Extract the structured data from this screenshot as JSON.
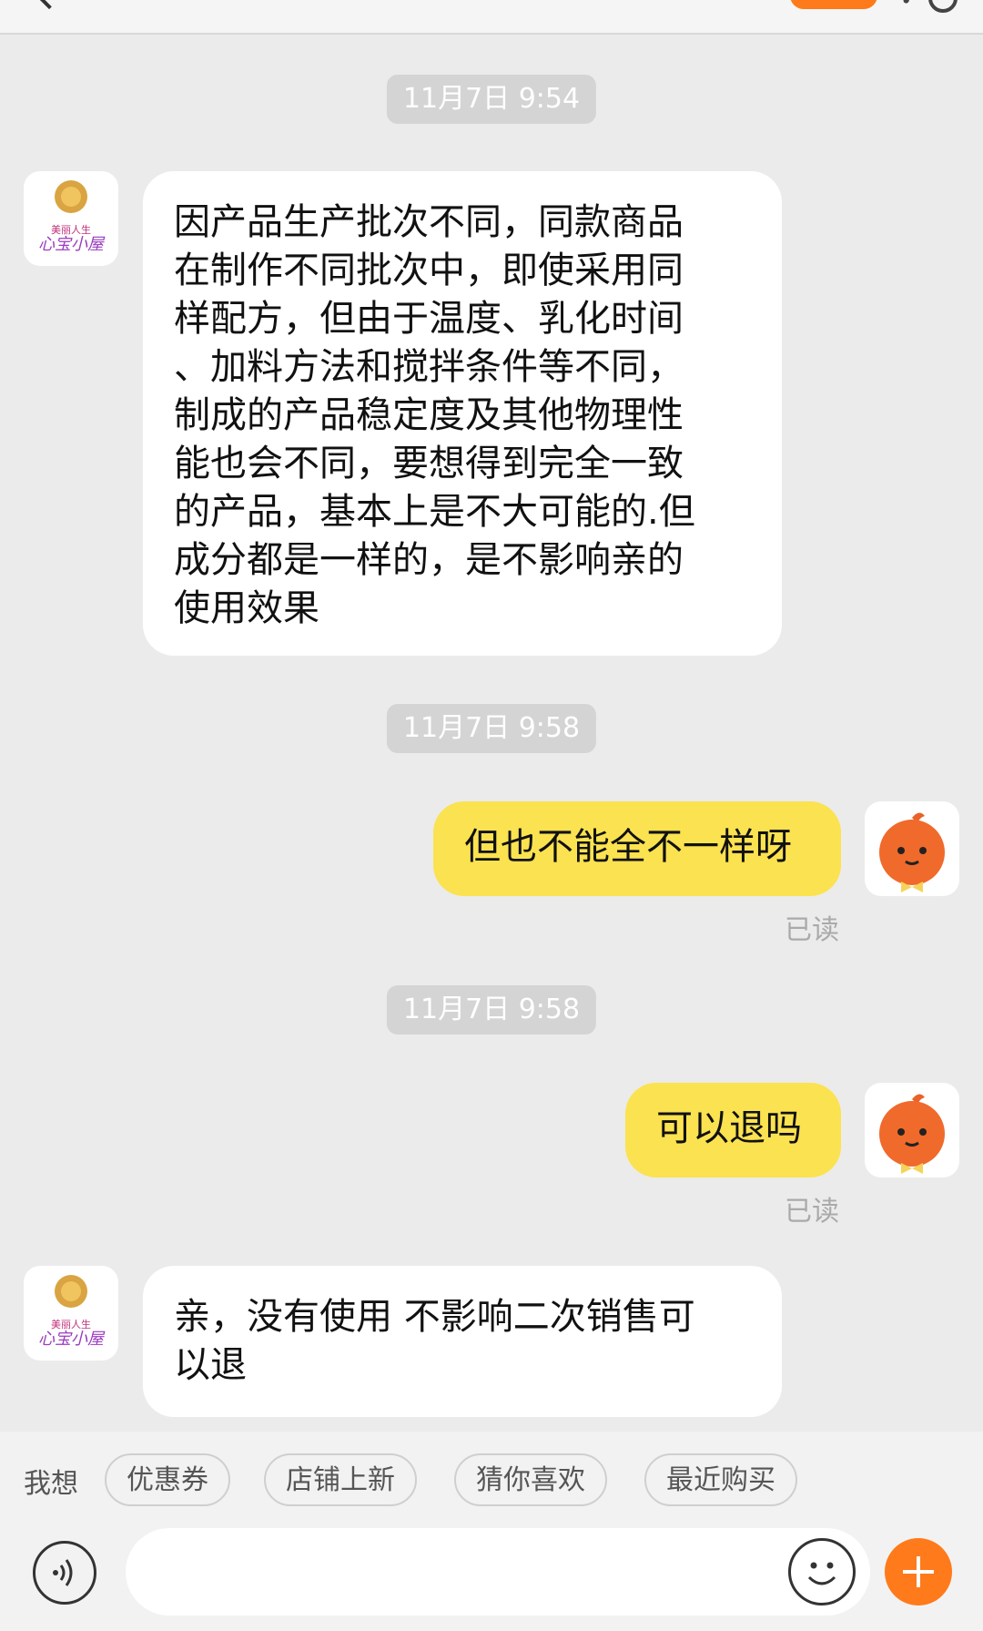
{
  "header": {},
  "messages": [
    {
      "time": "11月7日 9:54",
      "direction": "in",
      "lines": [
        "因产品生产批次不同，同款商品",
        "在制作不同批次中，即使采用同",
        "样配方，但由于温度、乳化时间",
        "、加料方法和搅拌条件等不同，",
        "制成的产品稳定度及其他物理性",
        "能也会不同，要想得到完全一致",
        "的产品，基本上是不大可能的.但",
        "成分都是一样的，是不影响亲的",
        "使用效果"
      ]
    },
    {
      "time": "11月7日 9:58",
      "direction": "out",
      "text": "但也不能全不一样呀",
      "status": "已读"
    },
    {
      "time": "11月7日 9:58",
      "direction": "out",
      "text": "可以退吗",
      "status": "已读"
    },
    {
      "direction": "in",
      "lines": [
        "亲，没有使用 不影响二次销售可",
        "以退"
      ]
    }
  ],
  "shop_avatar": {
    "text_line1": "美丽人生",
    "text_line2": "心宝小屋"
  },
  "quick_bar": {
    "label": "我想",
    "chips": [
      "优惠券",
      "店铺上新",
      "猜你喜欢",
      "最近购买"
    ]
  },
  "input": {
    "placeholder": ""
  },
  "colors": {
    "accent": "#ff7a1a",
    "out_bubble": "#fbe250",
    "background": "#ebebeb"
  }
}
